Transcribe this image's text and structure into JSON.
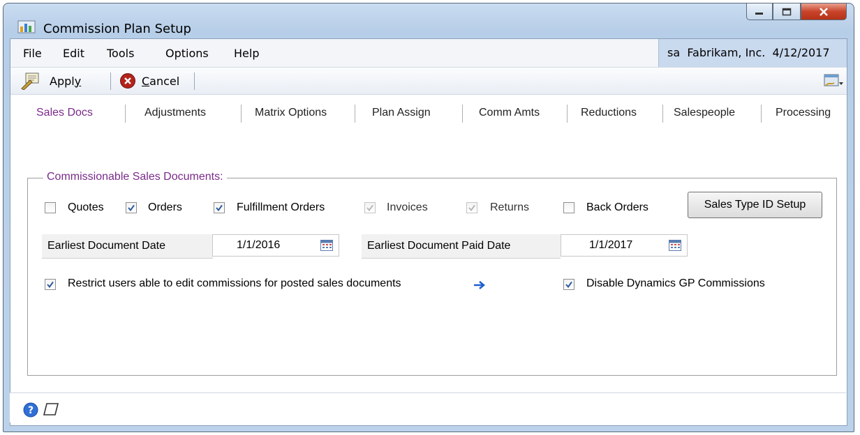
{
  "window": {
    "title": "Commission Plan Setup"
  },
  "menubar": {
    "items": [
      "File",
      "Edit",
      "Tools",
      "Options",
      "Help"
    ],
    "user": "sa  Fabrikam, Inc.  4/12/2017"
  },
  "toolbar": {
    "apply": "Apply",
    "cancel": "Cancel"
  },
  "tabs": [
    "Sales Docs",
    "Adjustments",
    "Matrix Options",
    "Plan Assign",
    "Comm Amts",
    "Reductions",
    "Salespeople",
    "Processing"
  ],
  "group": {
    "title": "Commissionable Sales Documents:",
    "checkboxes": [
      {
        "label": "Quotes",
        "checked": false,
        "enabled": true
      },
      {
        "label": "Orders",
        "checked": true,
        "enabled": true
      },
      {
        "label": "Fulfillment Orders",
        "checked": true,
        "enabled": true
      },
      {
        "label": "Invoices",
        "checked": true,
        "enabled": false
      },
      {
        "label": "Returns",
        "checked": true,
        "enabled": false
      },
      {
        "label": "Back Orders",
        "checked": false,
        "enabled": true
      }
    ],
    "sales_type_button": "Sales Type ID Setup",
    "earliest_doc_date_label": "Earliest Document Date",
    "earliest_doc_date": "1/1/2016",
    "earliest_paid_date_label": "Earliest Document Paid Date",
    "earliest_paid_date": "1/1/2017",
    "restrict_label": "Restrict users able to edit commissions for posted sales documents",
    "restrict_checked": true,
    "disable_label": "Disable Dynamics GP Commissions",
    "disable_checked": true
  },
  "colors": {
    "accent": "#7a2a8a",
    "title_bar": "#c9dcf0"
  }
}
